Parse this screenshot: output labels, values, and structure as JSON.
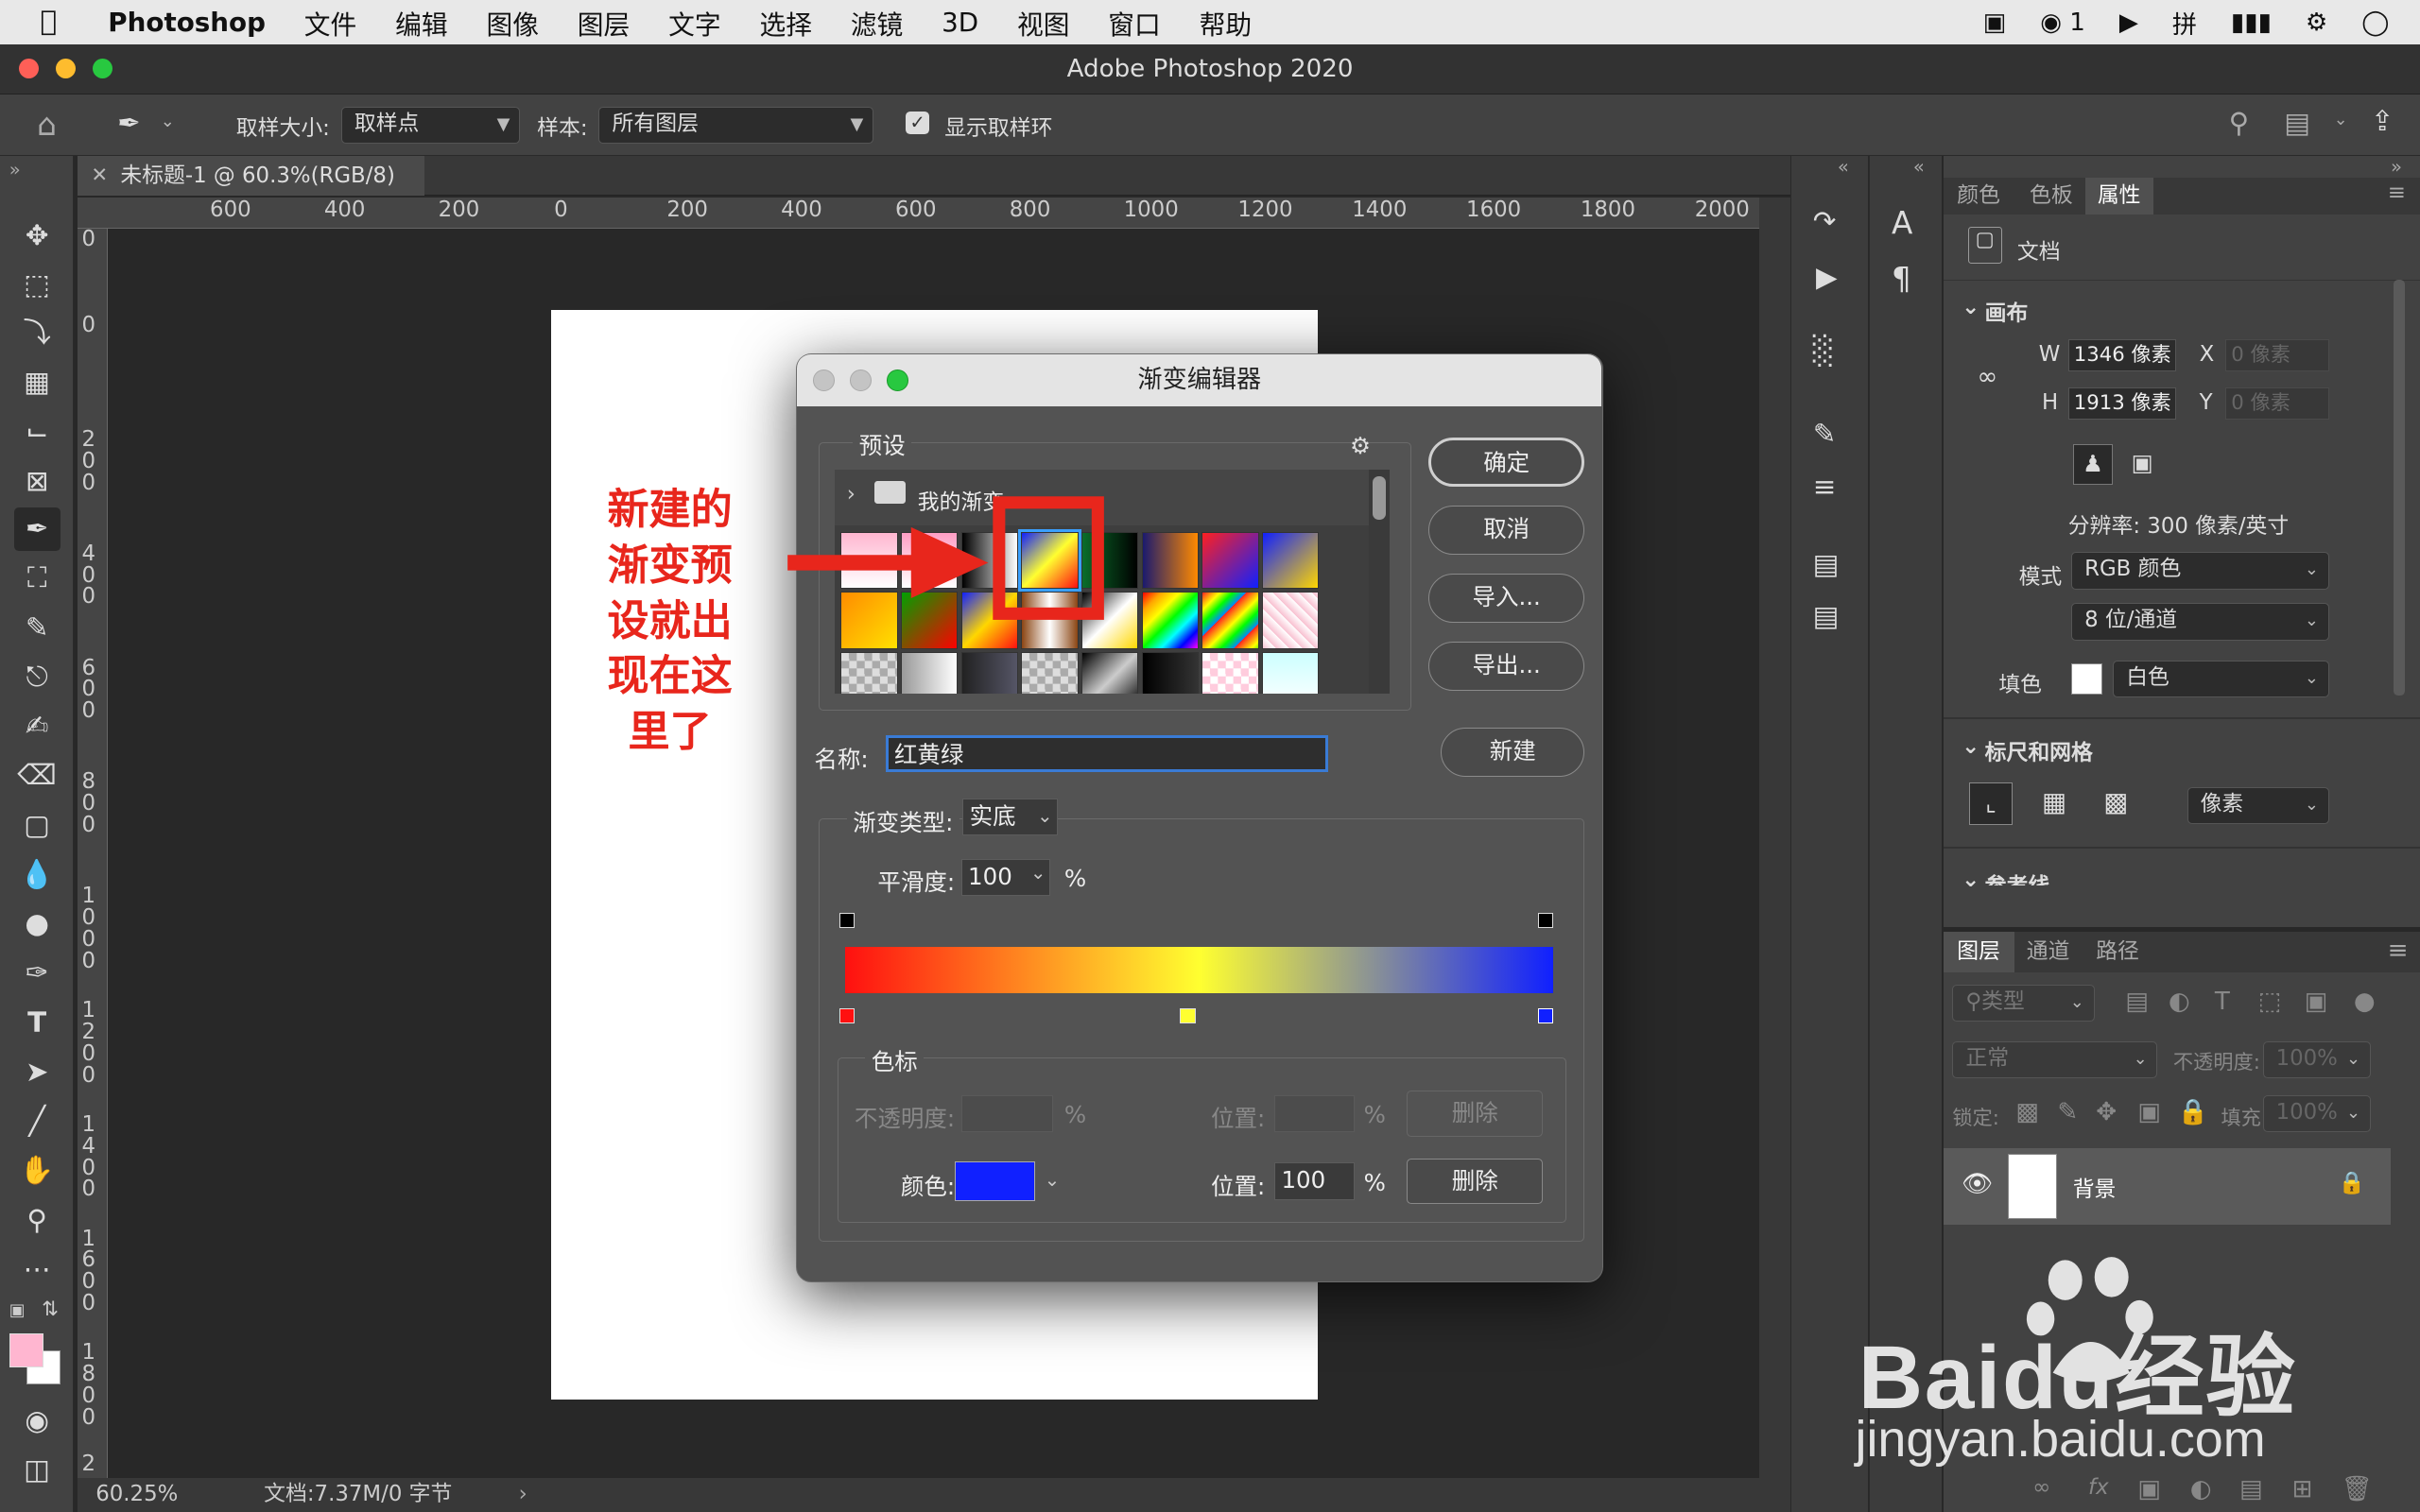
{
  "menubar": {
    "app": "Photoshop",
    "items": [
      "文件",
      "编辑",
      "图像",
      "图层",
      "文字",
      "选择",
      "滤镜",
      "3D",
      "视图",
      "窗口",
      "帮助"
    ],
    "wechat_count": "1"
  },
  "window": {
    "title": "Adobe Photoshop 2020"
  },
  "options": {
    "sample_size_label": "取样大小:",
    "sample_size_value": "取样点",
    "sample_label": "样本:",
    "sample_value": "所有图层",
    "show_ring_label": "显示取样环"
  },
  "document": {
    "tab_label": "未标题-1 @ 60.3%(RGB/8)",
    "zoom": "60.25%",
    "doc_info": "文档:7.37M/0 字节"
  },
  "ruler": {
    "h": [
      "600",
      "400",
      "200",
      "0",
      "200",
      "400",
      "600",
      "800",
      "1000",
      "1200",
      "1400",
      "1600",
      "1800",
      "2000"
    ],
    "v": [
      "0",
      "0",
      "2 0 0",
      "4 0 0",
      "6 0 0",
      "8 0 0",
      "1 0 0 0",
      "1 2 0 0",
      "1 4 0 0",
      "1 6 0 0",
      "1 8 0 0",
      "2"
    ]
  },
  "annotation": {
    "text": "新建的渐变预设就出现在这里了",
    "lines": [
      "新建的",
      "渐变预",
      "设就出",
      "现在这",
      "里了"
    ]
  },
  "dialog": {
    "title": "渐变编辑器",
    "presets_label": "预设",
    "folder_label": "我的渐变",
    "ok": "确定",
    "cancel": "取消",
    "import": "导入...",
    "export": "导出...",
    "name_label": "名称:",
    "name_value": "红黄绿",
    "new_button": "新建",
    "type_label": "渐变类型:",
    "type_value": "实底",
    "smooth_label": "平滑度:",
    "smooth_value": "100",
    "percent": "%",
    "stops_group": "色标",
    "opacity_label": "不透明度:",
    "location_label": "位置:",
    "delete_label": "删除",
    "color_label": "颜色:",
    "color_location": "100",
    "color_value": "#1020ff",
    "gradient_colors": [
      "#ff1010",
      "#ffff30",
      "#1020ff"
    ]
  },
  "properties": {
    "tabs": [
      "颜色",
      "色板",
      "属性"
    ],
    "doc_label": "文档",
    "canvas_section": "画布",
    "w_label": "W",
    "w_value": "1346 像素",
    "h_label": "H",
    "h_value": "1913 像素",
    "x_label": "X",
    "x_value": "0 像素",
    "y_label": "Y",
    "y_value": "0 像素",
    "resolution": "分辨率: 300 像素/英寸",
    "mode_label": "模式",
    "mode_value": "RGB 颜色",
    "bits_value": "8 位/通道",
    "fill_label": "填色",
    "fill_value": "白色",
    "rulers_section": "标尺和网格",
    "unit_value": "像素",
    "guides_section": "参考线"
  },
  "layers": {
    "tabs": [
      "图层",
      "通道",
      "路径"
    ],
    "filter_label": "类型",
    "blend_mode": "正常",
    "opacity_label": "不透明度:",
    "opacity_value": "100%",
    "lock_label": "锁定:",
    "fill_label": "填充:",
    "fill_value": "100%",
    "layer_name": "背景"
  },
  "watermark": {
    "brand": "Baidu经验",
    "url": "jingyan.baidu.com"
  }
}
